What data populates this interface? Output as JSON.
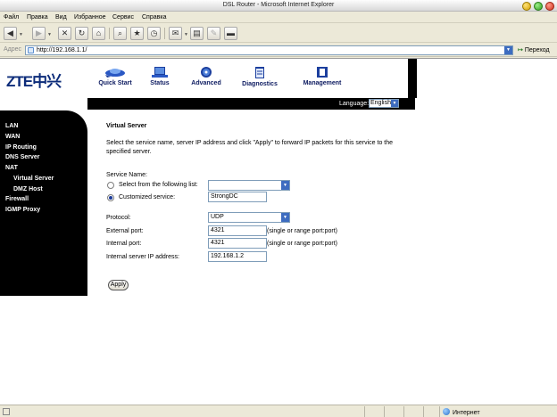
{
  "window": {
    "title": "DSL Router - Microsoft Internet Explorer"
  },
  "menu": {
    "items": [
      "Файл",
      "Правка",
      "Вид",
      "Избранное",
      "Сервис",
      "Справка"
    ]
  },
  "address": {
    "label": "Адрес",
    "url": "http://192.168.1.1/",
    "go_label": "Переход"
  },
  "brand": {
    "logo": "ZTE中兴"
  },
  "nav": {
    "items": [
      {
        "label": "Quick Start",
        "icon": "rocket-icon"
      },
      {
        "label": "Status",
        "icon": "laptop-icon"
      },
      {
        "label": "Advanced",
        "icon": "gear-icon"
      },
      {
        "label": "Diagnostics",
        "icon": "clipboard-icon"
      },
      {
        "label": "Management",
        "icon": "folder-icon"
      }
    ]
  },
  "language": {
    "label": "Language:",
    "value": "English"
  },
  "sidebar": {
    "items": [
      "LAN",
      "WAN",
      "IP Routing",
      "DNS Server",
      "NAT",
      "Virtual Server",
      "DMZ Host",
      "Firewall",
      "IGMP Proxy"
    ]
  },
  "form": {
    "heading": "Virtual Server",
    "description": "Select the service name, server IP address and click \"Apply\" to forward IP packets for this service to the specified server.",
    "service_name_label": "Service Name:",
    "option_list_label": "Select from the following list:",
    "option_list_value": "",
    "option_custom_label": "Customized service:",
    "custom_service_value": "StrongDC",
    "protocol_label": "Protocol:",
    "protocol_value": "UDP",
    "external_port_label": "External port:",
    "external_port_value": "4321",
    "external_port_hint": "(single or range port:port)",
    "internal_port_label": "Internal port:",
    "internal_port_value": "4321",
    "internal_port_hint": "(single or range port:port)",
    "server_ip_label": "Internal server IP address:",
    "server_ip_value": "192.168.1.2",
    "apply_label": "Apply"
  },
  "status": {
    "zone": "Интернет"
  }
}
